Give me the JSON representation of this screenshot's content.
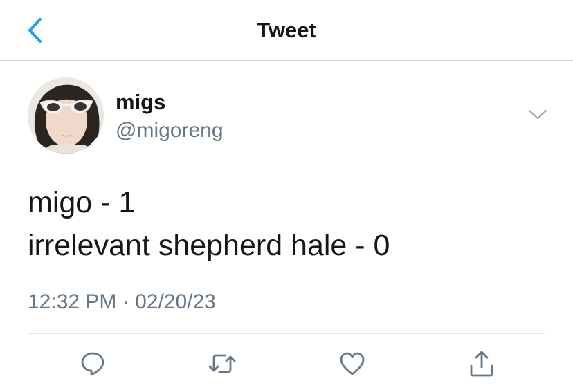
{
  "nav": {
    "title": "Tweet",
    "back_icon": "chevron-left-icon",
    "accent": "#1da1f2"
  },
  "tweet": {
    "author": {
      "display_name": "migs",
      "handle": "@migoreng"
    },
    "text_lines": [
      "migo - 1",
      "irrelevant shepherd hale - 0"
    ],
    "timestamp": "12:32 PM · 02/20/23"
  },
  "actions": [
    {
      "name": "reply",
      "icon": "comment-icon"
    },
    {
      "name": "retweet",
      "icon": "retweet-icon"
    },
    {
      "name": "like",
      "icon": "heart-icon"
    },
    {
      "name": "share",
      "icon": "share-icon"
    }
  ],
  "colors": {
    "text_primary": "#14171a",
    "text_secondary": "#657786",
    "icon_gray": "#657786",
    "divider": "#e1e8ed"
  }
}
